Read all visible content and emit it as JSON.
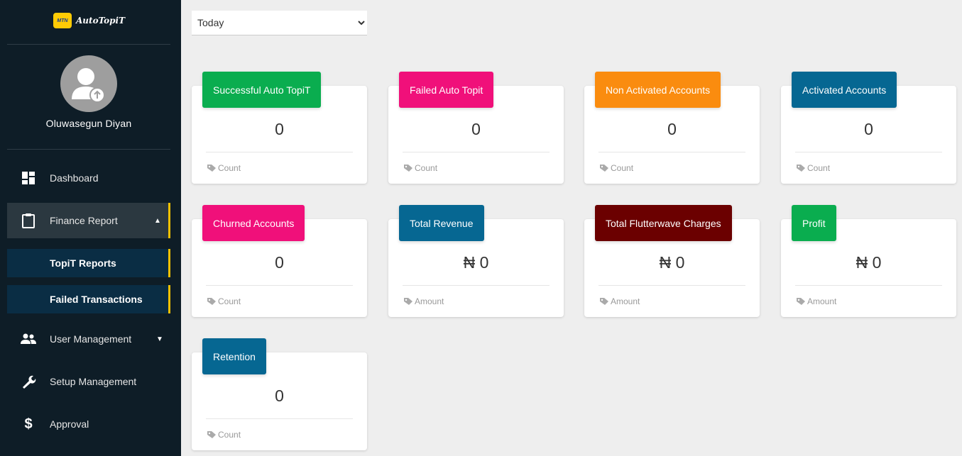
{
  "app": {
    "brand_logo_text": "MTN",
    "brand_name": "AutoTopiT"
  },
  "user": {
    "name": "Oluwasegun Diyan"
  },
  "sidebar": {
    "items": [
      {
        "label": "Dashboard",
        "icon": "dashboard-icon"
      },
      {
        "label": "Finance Report",
        "icon": "clipboard-icon",
        "expanded": true
      },
      {
        "label": "User Management",
        "icon": "users-icon"
      },
      {
        "label": "Setup Management",
        "icon": "wrench-icon"
      },
      {
        "label": "Approval",
        "icon": "dollar-icon"
      }
    ],
    "sub_items": [
      {
        "label": "TopiT Reports"
      },
      {
        "label": "Failed Transactions"
      }
    ]
  },
  "filter": {
    "selected": "Today",
    "options": [
      "Today"
    ]
  },
  "cards": [
    {
      "title": "Successful Auto TopiT",
      "value": "0",
      "footer": "Count",
      "color": "#0aad4f"
    },
    {
      "title": "Failed Auto Topit",
      "value": "0",
      "footer": "Count",
      "color": "#f0107a"
    },
    {
      "title": "Non Activated Accounts",
      "value": "0",
      "footer": "Count",
      "color": "#fa8c0f"
    },
    {
      "title": "Activated Accounts",
      "value": "0",
      "footer": "Count",
      "color": "#066792"
    },
    {
      "title": "Churned Accounts",
      "value": "0",
      "footer": "Count",
      "color": "#f0107a"
    },
    {
      "title": "Total Revenue",
      "value": "₦ 0",
      "footer": "Amount",
      "color": "#066792"
    },
    {
      "title": "Total Flutterwave Charges",
      "value": "₦ 0",
      "footer": "Amount",
      "color": "#6b0000"
    },
    {
      "title": "Profit",
      "value": "₦ 0",
      "footer": "Amount",
      "color": "#0aad4f"
    },
    {
      "title": "Retention",
      "value": "0",
      "footer": "Count",
      "color": "#066792"
    }
  ]
}
